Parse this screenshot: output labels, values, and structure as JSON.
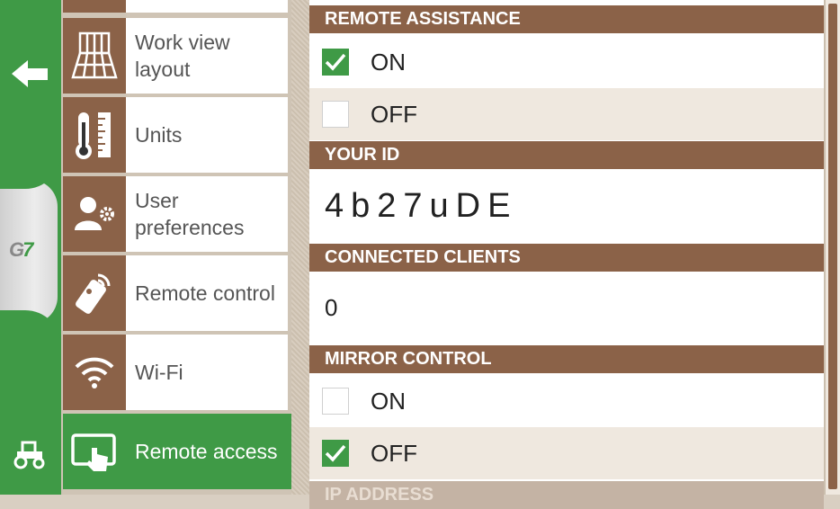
{
  "colors": {
    "accent": "#3f9a46",
    "header_brown": "#8b6248",
    "row_alt": "#efe8df"
  },
  "rail": {
    "back_icon": "back-arrow-icon",
    "logo_g": "G",
    "logo_7": "7",
    "tractor_icon": "tractor-icon"
  },
  "menu": {
    "items": [
      {
        "label": "Work view layout",
        "icon": "grid-layout-icon"
      },
      {
        "label": "Units",
        "icon": "thermometer-ruler-icon"
      },
      {
        "label": "User preferences",
        "icon": "user-settings-icon"
      },
      {
        "label": "Remote control",
        "icon": "remote-control-icon"
      },
      {
        "label": "Wi-Fi",
        "icon": "wifi-icon"
      },
      {
        "label": "Remote access",
        "icon": "tablet-touch-icon"
      }
    ]
  },
  "panel": {
    "remote_assistance": {
      "header": "REMOTE ASSISTANCE",
      "on_label": "ON",
      "on_checked": true,
      "off_label": "OFF",
      "off_checked": false
    },
    "your_id": {
      "header": "YOUR ID",
      "value": "4b27uDE"
    },
    "connected_clients": {
      "header": "CONNECTED CLIENTS",
      "value": "0"
    },
    "mirror_control": {
      "header": "MIRROR CONTROL",
      "on_label": "ON",
      "on_checked": false,
      "off_label": "OFF",
      "off_checked": true
    },
    "next_header": "IP ADDRESS"
  }
}
